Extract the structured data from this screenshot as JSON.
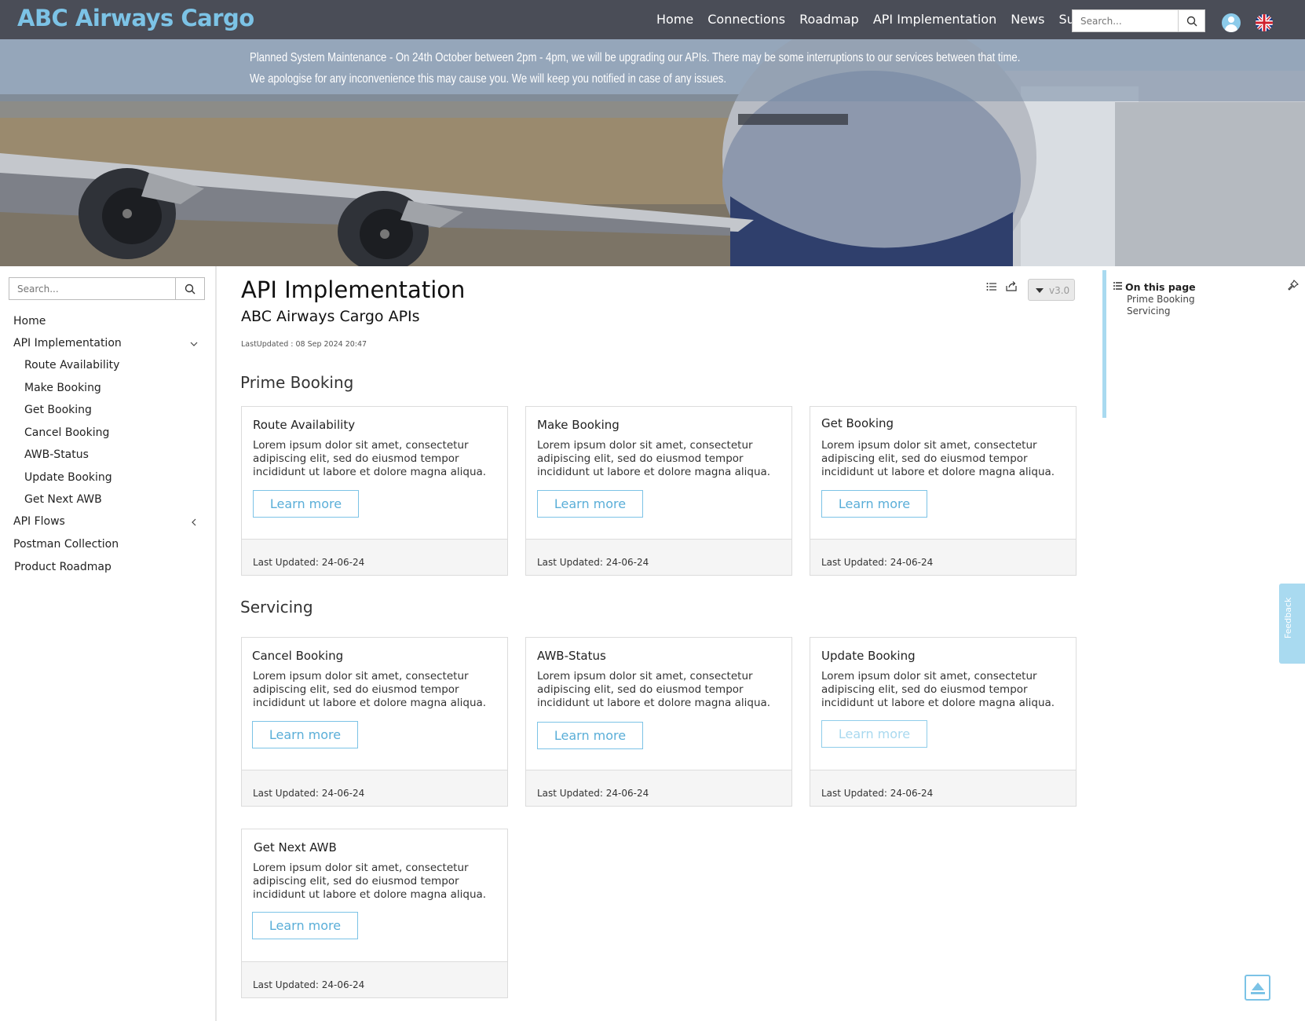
{
  "header": {
    "brand": "ABC Airways Cargo",
    "nav": [
      "Home",
      "Connections",
      "Roadmap",
      "API Implementation",
      "News",
      "Support"
    ],
    "search_placeholder": "Search..."
  },
  "hero": {
    "line1": "Planned System Maintenance - On 24th October between 2pm - 4pm, we will be upgrading our APIs. There may be some interruptions to our services between that time.",
    "line2": "We apologise for any inconvenience this may cause you. We will keep you notified in case of any issues."
  },
  "sidebar": {
    "search_placeholder": "Search...",
    "items": [
      {
        "label": "Home"
      },
      {
        "label": "API Implementation"
      },
      {
        "label": "Route Availability"
      },
      {
        "label": "Make Booking"
      },
      {
        "label": "Get Booking"
      },
      {
        "label": "Cancel Booking"
      },
      {
        "label": "AWB-Status"
      },
      {
        "label": "Update Booking"
      },
      {
        "label": "Get Next AWB"
      },
      {
        "label": "API Flows"
      },
      {
        "label": "Postman Collection"
      },
      {
        "label": "Product Roadmap"
      }
    ]
  },
  "main": {
    "title": "API Implementation",
    "subtitle": "ABC Airways Cargo APIs",
    "last_updated": "LastUpdated : 08 Sep 2024 20:47",
    "version": "v3.0",
    "sections": [
      {
        "title": "Prime Booking"
      },
      {
        "title": "Servicing"
      }
    ],
    "cards": [
      {
        "title": "Route Availability",
        "desc": "Lorem ipsum dolor sit amet, consectetur adipiscing elit, sed do eiusmod tempor incididunt ut labore et dolore magna aliqua.",
        "button": "Learn more",
        "footer": "Last Updated: 24-06-24"
      },
      {
        "title": "Make Booking",
        "desc": "Lorem ipsum dolor sit amet, consectetur adipiscing elit, sed do eiusmod tempor incididunt ut labore et dolore magna aliqua.",
        "button": "Learn more",
        "footer": "Last Updated: 24-06-24"
      },
      {
        "title": "Get Booking",
        "desc": "Lorem ipsum dolor sit amet, consectetur adipiscing elit, sed do eiusmod tempor incididunt ut labore et dolore magna aliqua.",
        "button": "Learn more",
        "footer": "Last Updated: 24-06-24"
      },
      {
        "title": "Cancel Booking",
        "desc": "Lorem ipsum dolor sit amet, consectetur adipiscing elit, sed do eiusmod tempor incididunt ut labore et dolore magna aliqua.",
        "button": "Learn more",
        "footer": "Last Updated: 24-06-24"
      },
      {
        "title": "AWB-Status",
        "desc": "Lorem ipsum dolor sit amet, consectetur adipiscing elit, sed do eiusmod tempor incididunt ut labore et dolore magna aliqua.",
        "button": "Learn more",
        "footer": "Last Updated: 24-06-24"
      },
      {
        "title": "Update Booking",
        "desc": "Lorem ipsum dolor sit amet, consectetur adipiscing elit, sed do eiusmod tempor incididunt ut labore et dolore magna aliqua.",
        "button": "Learn more",
        "footer": "Last Updated: 24-06-24"
      },
      {
        "title": "Get Next AWB",
        "desc": "Lorem ipsum dolor sit amet, consectetur adipiscing elit, sed do eiusmod tempor incididunt ut labore et dolore magna aliqua.",
        "button": "Learn more",
        "footer": "Last Updated: 24-06-24"
      }
    ]
  },
  "toc": {
    "heading": "On this page",
    "links": [
      "Prime Booking",
      "Servicing"
    ]
  },
  "feedback": {
    "label": "Feedback"
  },
  "icons": {
    "search": "search-icon",
    "user": "user-icon",
    "language": "uk-flag-icon",
    "list": "list-icon",
    "share": "share-icon",
    "pin": "pin-icon",
    "scroll_top": "scroll-to-top-icon"
  },
  "colors": {
    "brand": "#7cc3e6",
    "topbar": "#4a4d57",
    "accent": "#5aaed8"
  }
}
